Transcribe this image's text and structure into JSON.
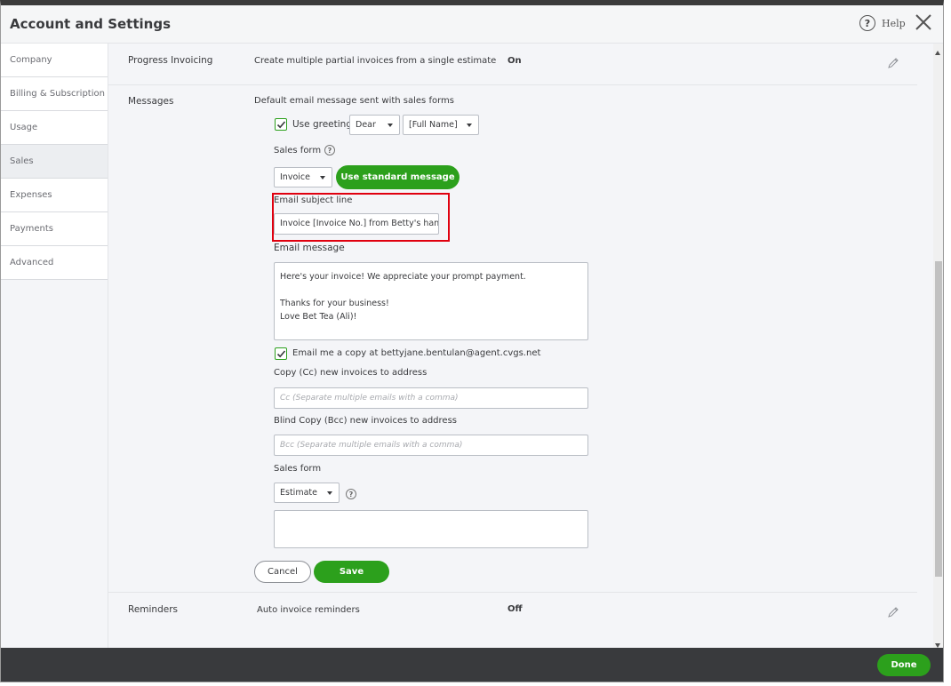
{
  "window": {
    "title": "Account and Settings",
    "help_label": "Help"
  },
  "sidebar": {
    "items": [
      {
        "label": "Company"
      },
      {
        "label": "Billing & Subscription"
      },
      {
        "label": "Usage"
      },
      {
        "label": "Sales"
      },
      {
        "label": "Expenses"
      },
      {
        "label": "Payments"
      },
      {
        "label": "Advanced"
      }
    ],
    "active": "Sales"
  },
  "progress_invoicing": {
    "label": "Progress Invoicing",
    "description": "Create multiple partial invoices from a single estimate",
    "value": "On"
  },
  "messages": {
    "label": "Messages",
    "description": "Default email message sent with sales forms",
    "use_greeting_label": "Use greeting",
    "greeting_value": "Dear",
    "name_value": "[Full Name]",
    "sales_form_label": "Sales form",
    "sales_form_value": "Invoice",
    "use_standard_label": "Use standard message",
    "subject_label": "Email subject line",
    "subject_value": "Invoice [Invoice No.] from Betty's handi",
    "email_message_label": "Email message",
    "email_message_value": "Here's your invoice! We appreciate your prompt payment.\n\nThanks for your business!\nLove Bet Tea (Ali)!",
    "email_copy_label": "Email me a copy at bettyjane.bentulan@agent.cvgs.net",
    "cc_label": "Copy (Cc) new invoices to address",
    "cc_placeholder": "Cc (Separate multiple emails with a comma)",
    "bcc_label": "Blind Copy (Bcc) new invoices to address",
    "bcc_placeholder": "Bcc (Separate multiple emails with a comma)",
    "sales_form2_label": "Sales form",
    "sales_form2_value": "Estimate",
    "cancel_label": "Cancel",
    "save_label": "Save"
  },
  "reminders": {
    "label": "Reminders",
    "description": "Auto invoice reminders",
    "value": "Off"
  },
  "footer": {
    "done_label": "Done"
  },
  "colors": {
    "accent": "#2ca01c",
    "highlight": "#e0000f",
    "footer": "#393a3d"
  }
}
